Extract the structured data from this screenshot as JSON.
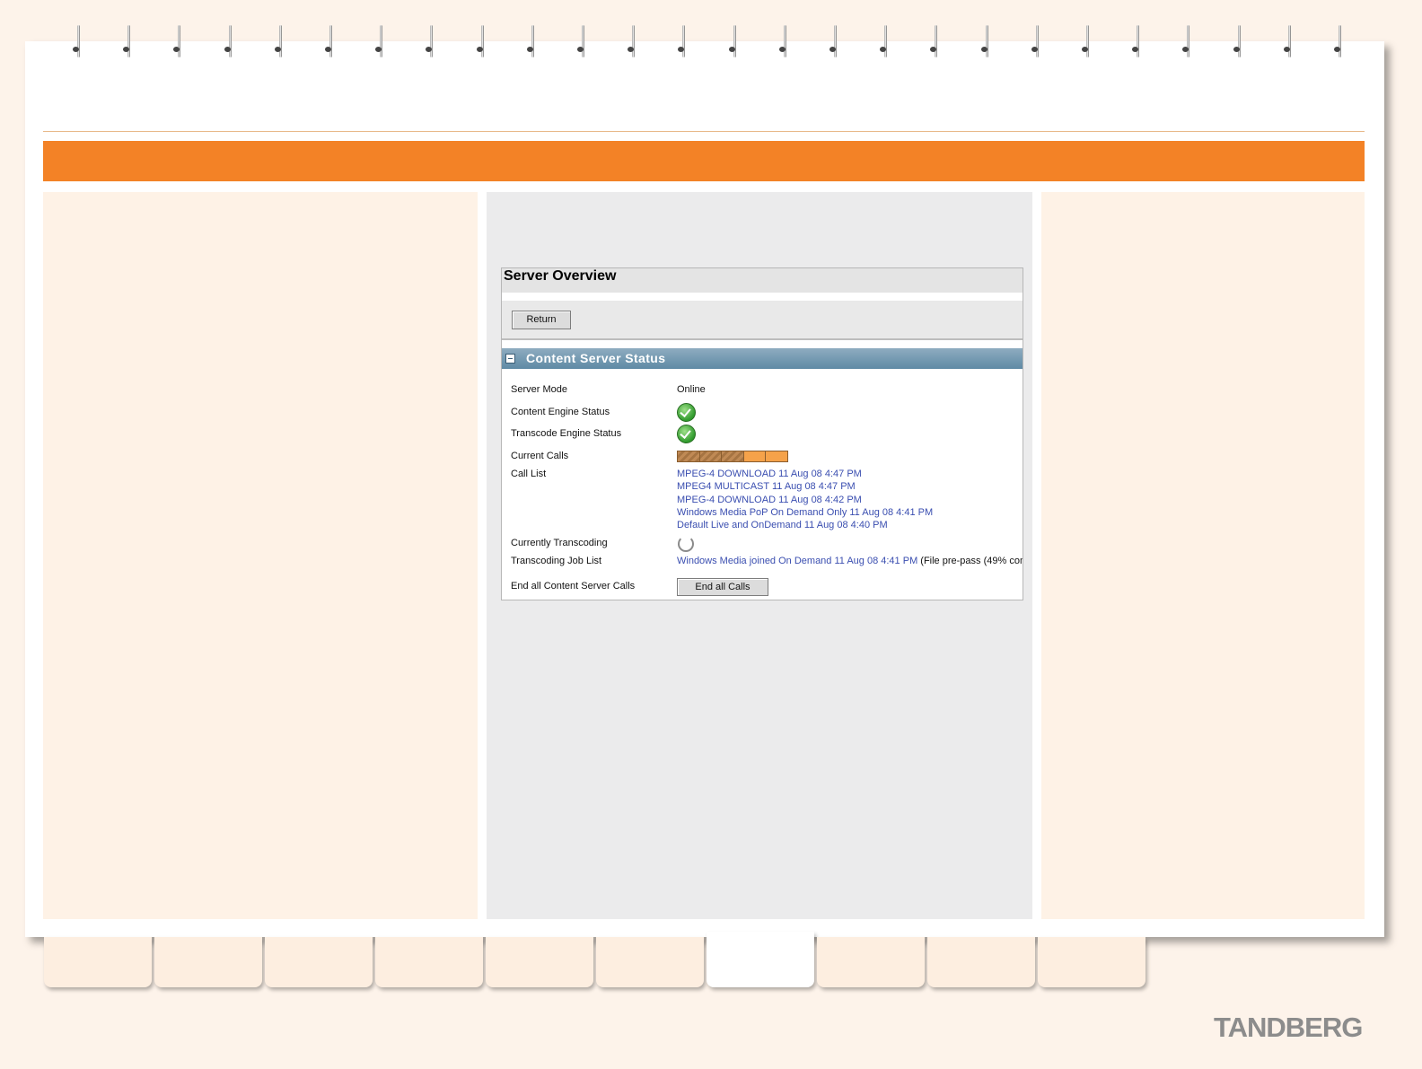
{
  "panel": {
    "title": "Server Overview",
    "return_label": "Return",
    "section_title": "Content Server Status",
    "rows": {
      "server_mode_label": "Server Mode",
      "server_mode_value": "Online",
      "content_engine_label": "Content Engine Status",
      "transcode_engine_label": "Transcode Engine Status",
      "current_calls_label": "Current Calls",
      "call_list_label": "Call List",
      "currently_transcoding_label": "Currently Transcoding",
      "transcoding_job_list_label": "Transcoding Job List",
      "end_all_label": "End all Content Server Calls"
    },
    "current_calls": {
      "active": 3,
      "total": 5
    },
    "call_list": [
      "MPEG-4 DOWNLOAD 11 Aug 08 4:47 PM",
      "MPEG4 MULTICAST 11 Aug 08 4:47 PM",
      "MPEG-4 DOWNLOAD 11 Aug 08 4:42 PM",
      "Windows Media PoP On Demand Only 11 Aug 08 4:41 PM",
      "Default Live and OnDemand 11 Aug 08 4:40 PM"
    ],
    "job_link": "Windows Media joined On Demand 11 Aug 08 4:41 PM",
    "job_status": " (File pre-pass (49% com",
    "end_all_button": "End all Calls"
  },
  "brand": "TANDBERG",
  "colors": {
    "accent": "#f38226",
    "link": "#3a4eb0",
    "section_header": "#6f96ae"
  }
}
